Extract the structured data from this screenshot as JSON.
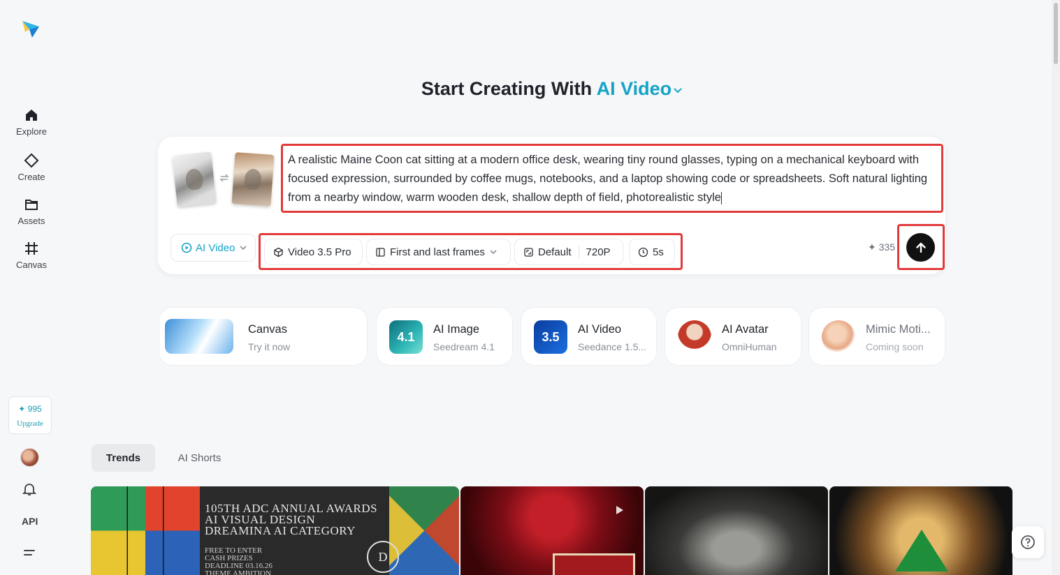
{
  "sidebar": {
    "items": [
      {
        "label": "Explore",
        "icon": "home-icon"
      },
      {
        "label": "Create",
        "icon": "create-icon"
      },
      {
        "label": "Assets",
        "icon": "folder-icon"
      },
      {
        "label": "Canvas",
        "icon": "canvas-icon"
      }
    ],
    "credits": "✦ 995",
    "upgrade_label": "Upgrade",
    "api_label": "API"
  },
  "header": {
    "title_prefix": "Start Creating With",
    "title_accent": "AI Video"
  },
  "prompt": {
    "text": "A realistic Maine Coon cat sitting at a modern office desk, wearing tiny round glasses, typing on a mechanical keyboard with focused expression, surrounded by coffee mugs, notebooks, and a laptop showing code or spreadsheets. Soft natural lighting from a nearby window, warm wooden desk, shallow depth of field, photorealistic style",
    "mode_label": "AI Video",
    "model_label": "Video 3.5 Pro",
    "frames_label": "First and last frames",
    "ratio_label": "Default",
    "resolution_label": "720P",
    "duration_label": "5s",
    "credit_cost": "✦ 335"
  },
  "tools": [
    {
      "name": "Canvas",
      "sub": "Try it now"
    },
    {
      "name": "AI Image",
      "sub": "Seedream 4.1"
    },
    {
      "name": "AI Video",
      "sub": "Seedance 1.5..."
    },
    {
      "name": "AI Avatar",
      "sub": "OmniHuman"
    },
    {
      "name": "Mimic Moti...",
      "sub": "Coming soon"
    }
  ],
  "tabs": [
    {
      "label": "Trends",
      "active": true
    },
    {
      "label": "AI Shorts",
      "active": false
    }
  ],
  "gallery": {
    "card1_title": "105TH ADC ANNUAL AWARDS\nAI VISUAL DESIGN\nDREAMINA AI CATEGORY",
    "card1_small": "FREE TO ENTER\nCASH PRIZES\nDEADLINE 03.16.26\nTHEME AMBITION"
  },
  "colors": {
    "accent": "#14a3c7",
    "highlight": "#e23a3a",
    "send": "#111111"
  }
}
